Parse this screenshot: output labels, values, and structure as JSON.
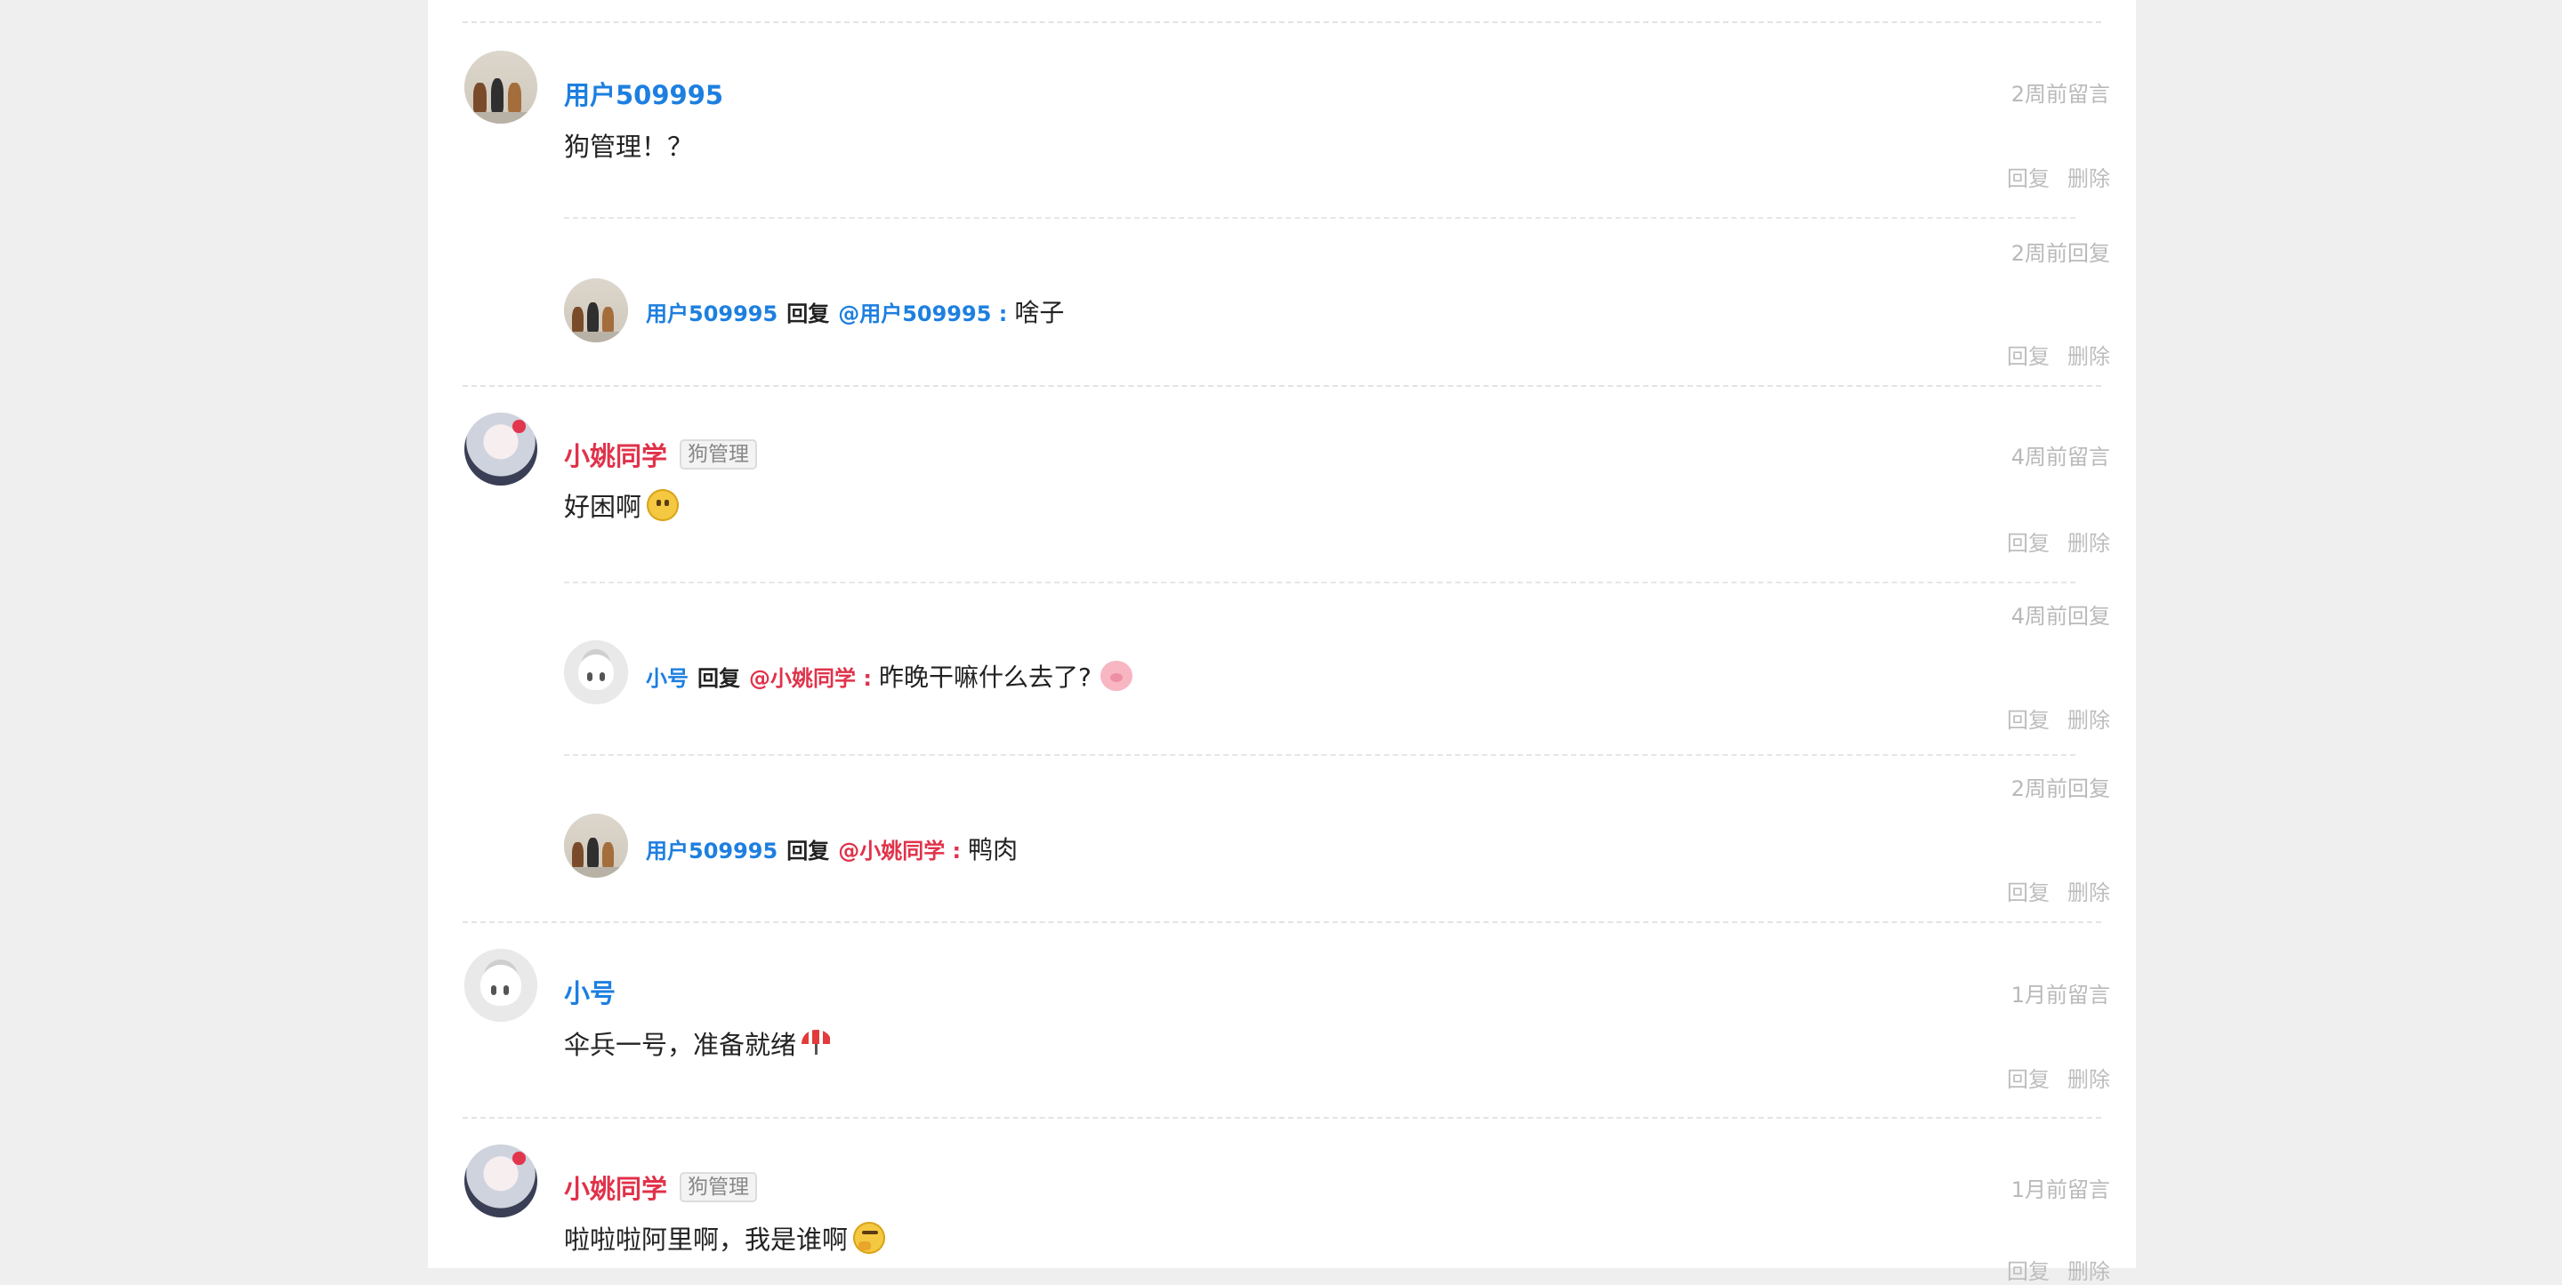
{
  "actions": {
    "reply": "回复",
    "delete": "删除"
  },
  "reply_keyword": "回复",
  "comments": [
    {
      "user": "用户509995",
      "user_color": "#1d7fe0",
      "badge": "",
      "time": "2周前留言",
      "text": "狗管理！？",
      "avatar": "figures-photo",
      "replies": [
        {
          "time": "2周前回复",
          "user": "用户509995",
          "target": "@用户509995 :",
          "text": "啥子",
          "avatar": "figures-photo"
        }
      ]
    },
    {
      "user": "小姚同学",
      "user_color": "#e0324a",
      "badge": "狗管理",
      "time": "4周前留言",
      "text": "好困啊",
      "emoji": "confused-face",
      "avatar": "anime-girl",
      "replies": [
        {
          "time": "4周前回复",
          "user": "小号",
          "target": "@小姚同学 :",
          "text": "昨晚干嘛什么去了?",
          "emoji": "pig-face",
          "avatar": "default-avatar"
        },
        {
          "time": "2周前回复",
          "user": "用户509995",
          "target": "@小姚同学 :",
          "text": "鸭肉",
          "avatar": "figures-photo"
        }
      ]
    },
    {
      "user": "小号",
      "user_color": "#1d7fe0",
      "badge": "",
      "time": "1月前留言",
      "text": "伞兵一号，准备就绪",
      "emoji": "beach-umbrella",
      "avatar": "default-avatar"
    },
    {
      "user": "小姚同学",
      "user_color": "#e0324a",
      "badge": "狗管理",
      "time": "1月前留言",
      "text": "啦啦啦阿里啊，我是谁啊",
      "emoji": "thinking-face",
      "avatar": "anime-girl"
    }
  ]
}
